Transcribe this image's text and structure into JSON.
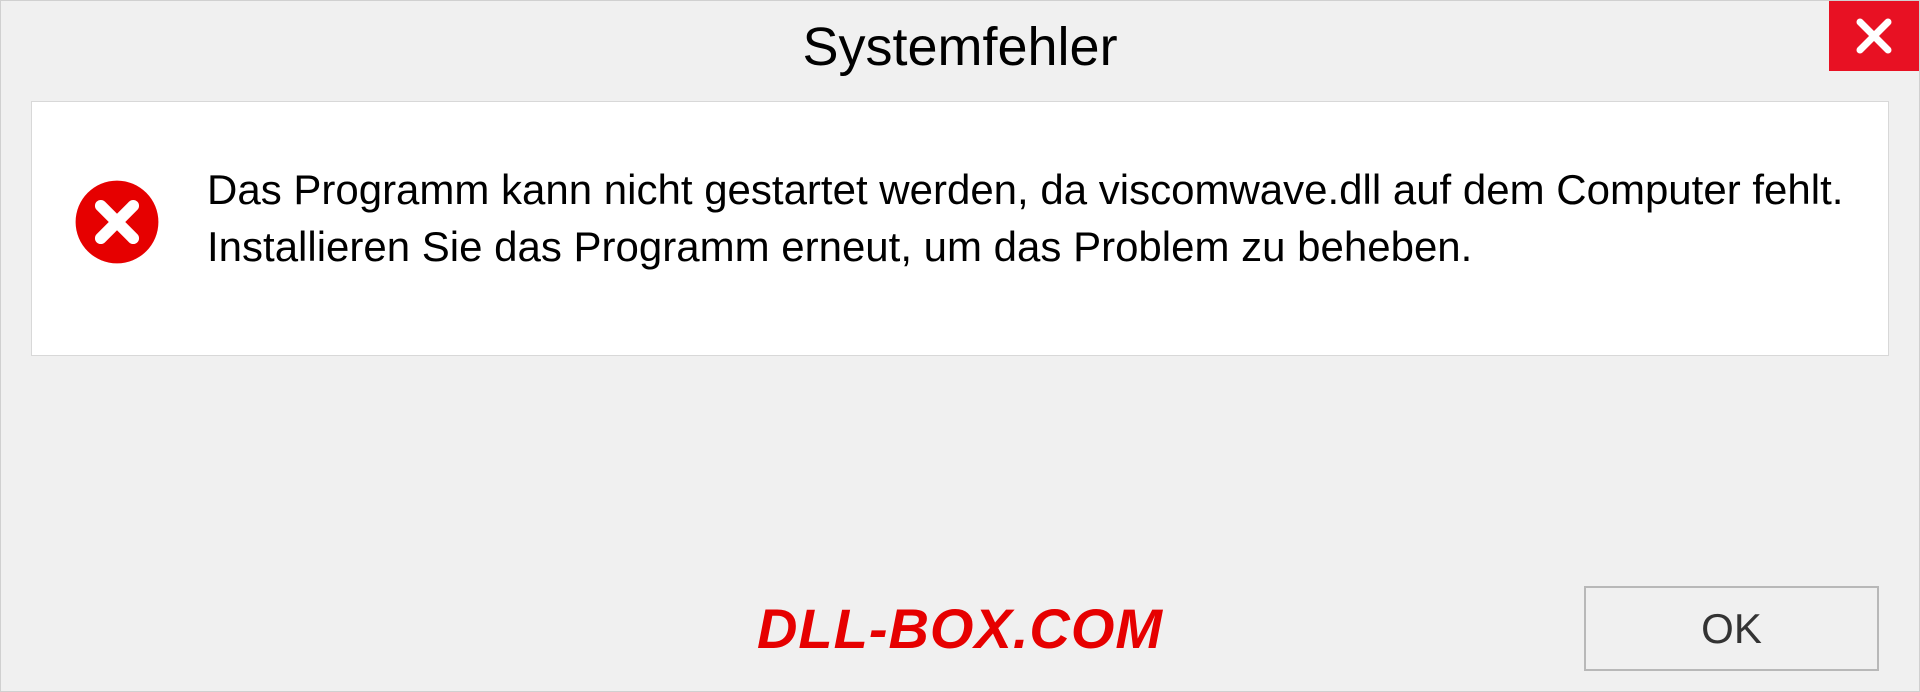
{
  "dialog": {
    "title": "Systemfehler",
    "message": "Das Programm kann nicht gestartet werden, da viscomwave.dll auf dem Computer fehlt. Installieren Sie das Programm erneut, um das Problem zu beheben.",
    "ok_label": "OK"
  },
  "watermark": "DLL-BOX.COM"
}
